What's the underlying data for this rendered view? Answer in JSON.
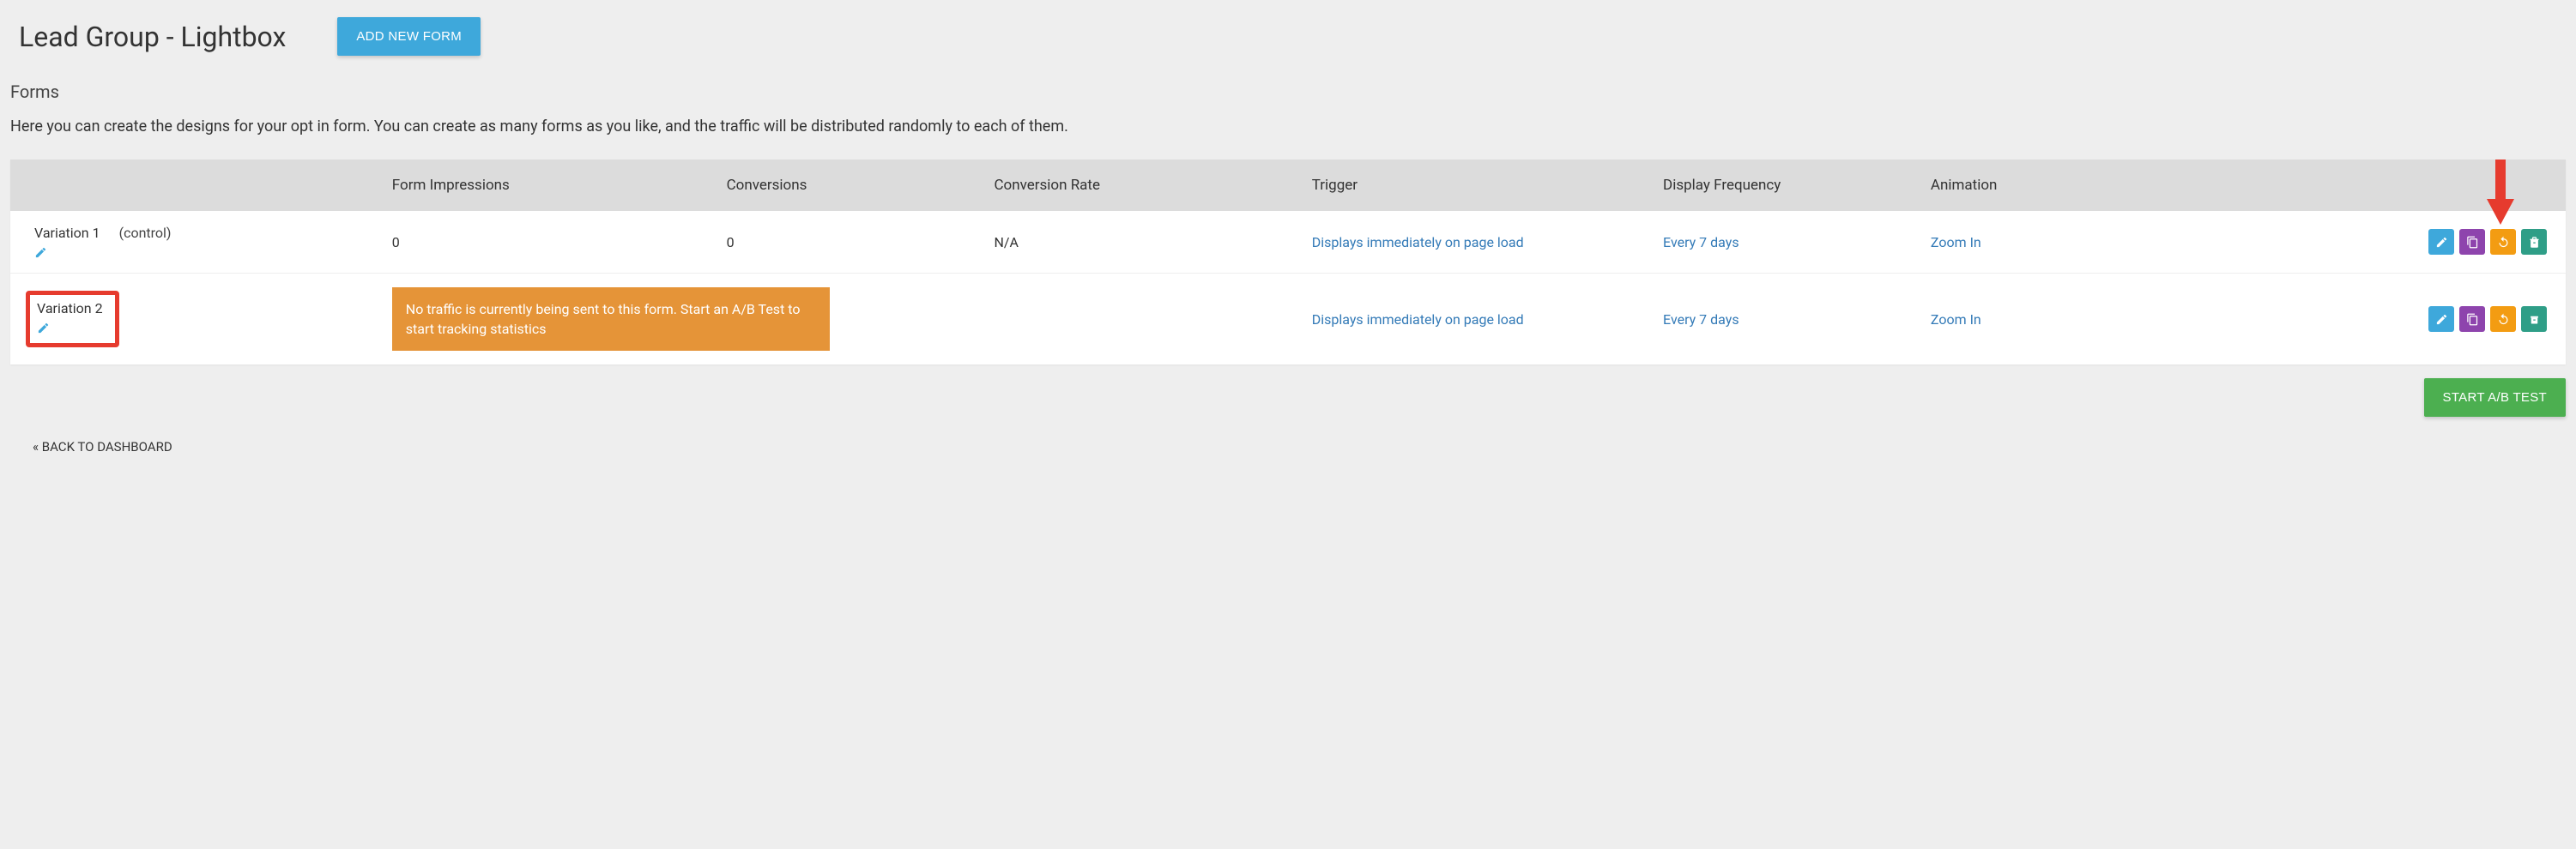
{
  "header": {
    "title": "Lead Group - Lightbox",
    "add_btn": "ADD NEW FORM"
  },
  "section": {
    "name": "Forms",
    "desc": "Here you can create the designs for your opt in form. You can create as many forms as you like, and the traffic will be distributed randomly to each of them."
  },
  "table": {
    "headers": {
      "name": "",
      "impressions": "Form Impressions",
      "conversions": "Conversions",
      "rate": "Conversion Rate",
      "trigger": "Trigger",
      "frequency": "Display Frequency",
      "animation": "Animation",
      "actions": ""
    },
    "rows": [
      {
        "name": "Variation 1",
        "control_label": "(control)",
        "impressions": "0",
        "conversions": "0",
        "rate": "N/A",
        "trigger": "Displays immediately on page load",
        "frequency": "Every 7 days",
        "animation": "Zoom In"
      },
      {
        "name": "Variation 2",
        "notice": "No traffic is currently being sent to this form. Start an A/B Test to start tracking statistics",
        "trigger": "Displays immediately on page load",
        "frequency": "Every 7 days",
        "animation": "Zoom In"
      }
    ]
  },
  "footer": {
    "start_btn": "START A/B TEST",
    "back_link": "« BACK TO DASHBOARD"
  }
}
